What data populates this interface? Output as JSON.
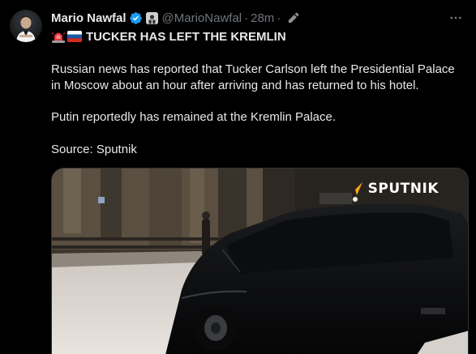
{
  "author": {
    "name": "Mario Nawfal",
    "handle": "@MarioNawfal",
    "separator": "·",
    "time": "28m",
    "separator2": "·"
  },
  "icons": {
    "verified": "verified-badge-icon",
    "affiliate": "affiliate-badge-icon",
    "edit": "edit-pencil-icon",
    "more": "more-options-icon",
    "siren": "siren-emoji-icon",
    "flag": "russia-flag-icon"
  },
  "tweet": {
    "headline": "TUCKER HAS LEFT THE KREMLIN",
    "paragraph1": "Russian news has reported that Tucker Carlson left the Presidential Palace in Moscow about an hour after arriving and has returned to his hotel.",
    "paragraph2": "Putin reportedly has remained at the Kremlin Palace.",
    "paragraph3": "Source: Sputnik"
  },
  "media": {
    "watermark": "SPUTNIK"
  },
  "colors": {
    "background": "#000000",
    "text": "#e7e9ea",
    "muted": "#71767b",
    "verified": "#1d9bf0",
    "watermark_accent": "#f7a51f"
  }
}
